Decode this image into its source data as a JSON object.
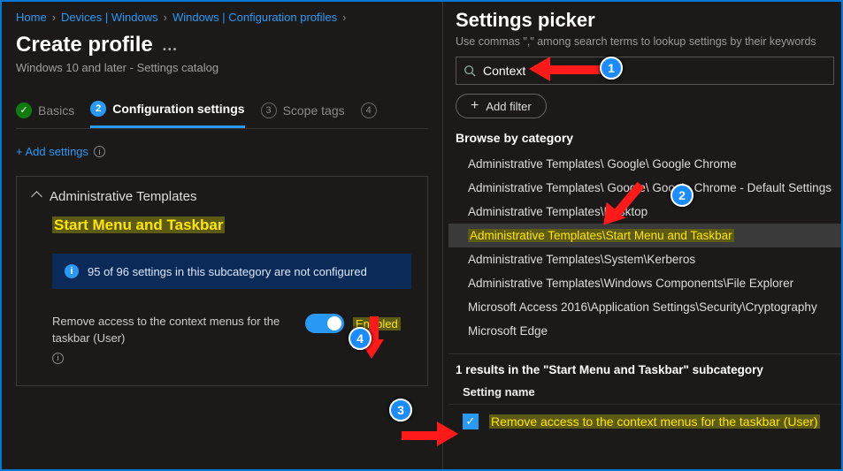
{
  "breadcrumbs": [
    "Home",
    "Devices | Windows",
    "Windows | Configuration profiles"
  ],
  "page": {
    "title": "Create profile",
    "subtitle": "Windows 10 and later - Settings catalog"
  },
  "steps": {
    "s1": "Basics",
    "s2": "Configuration settings",
    "s3_num": "3",
    "s3": "Scope tags",
    "s4_num": "4"
  },
  "add_settings": "+ Add settings",
  "panel": {
    "header": "Administrative Templates",
    "subcat": "Start Menu and Taskbar",
    "notice": "95 of 96 settings in this subcategory are not configured",
    "setting_label": "Remove access to the context menus for the taskbar (User)",
    "toggle_state": "Enabled"
  },
  "picker": {
    "title": "Settings picker",
    "subtitle": "Use commas \",\" among search terms to lookup settings by their keywords",
    "search_value": "Context",
    "add_filter": "Add filter",
    "browse_label": "Browse by category",
    "categories": [
      "Administrative Templates\\ Google\\ Google Chrome",
      "Administrative Templates\\ Google\\ Google Chrome - Default Settings",
      "Administrative Templates\\Desktop",
      "Administrative Templates\\Start Menu and Taskbar",
      "Administrative Templates\\System\\Kerberos",
      "Administrative Templates\\Windows Components\\File Explorer",
      "Microsoft Access 2016\\Application Settings\\Security\\Cryptography",
      "Microsoft Edge"
    ],
    "selected_index": 3,
    "results_header": "1 results in the \"Start Menu and Taskbar\" subcategory",
    "column_header": "Setting name",
    "result_name": "Remove access to the context menus for the taskbar (User)"
  },
  "annotations": {
    "b1": "1",
    "b2": "2",
    "b3": "3",
    "b4": "4"
  },
  "colors": {
    "accent": "#2899f5",
    "highlight_bg": "#5d5b13",
    "highlight_fg": "#ffe600",
    "arrow": "#ff1a1a"
  }
}
